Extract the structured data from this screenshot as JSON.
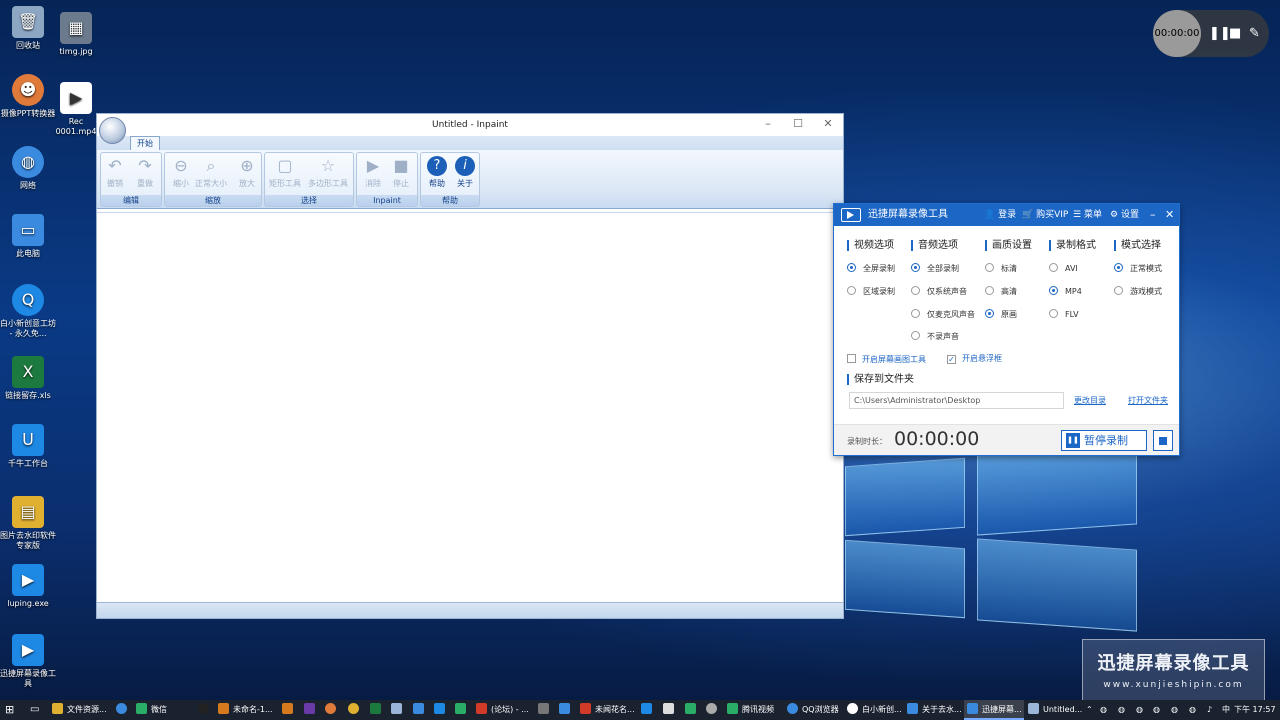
{
  "desktop": {
    "icons": [
      {
        "label": "回收站",
        "icon": "recycle-bin-icon",
        "color": "#8ca6c4"
      },
      {
        "label": "timg.jpg",
        "icon": "image-file-icon",
        "color": "#6b7a8c"
      },
      {
        "label": "摄像PPT转换器",
        "icon": "ppt-converter-icon",
        "color": "#e07a3a"
      },
      {
        "label": "Rec 0001.mp4",
        "icon": "video-file-icon",
        "color": "#ffffff"
      },
      {
        "label": "网络",
        "icon": "network-icon",
        "color": "#3a8ae0"
      },
      {
        "label": "此电脑",
        "icon": "computer-icon",
        "color": "#3a8ae0"
      },
      {
        "label": "白小新创意工坊 - 永久免...",
        "icon": "app-icon",
        "color": "#1e88e5"
      },
      {
        "label": "链接留存.xls",
        "icon": "excel-file-icon",
        "color": "#1d7a3e"
      },
      {
        "label": "千牛工作台",
        "icon": "qianniu-icon",
        "color": "#1e88e5"
      },
      {
        "label": "图片去水印软件专家版",
        "icon": "folder-icon",
        "color": "#e0b030"
      },
      {
        "label": "luping.exe",
        "icon": "recorder-app-icon",
        "color": "#1e88e5"
      },
      {
        "label": "迅捷屏幕录像工具",
        "icon": "recorder-app-icon",
        "color": "#1e88e5"
      }
    ]
  },
  "float_recorder": {
    "time": "00:00:00"
  },
  "inpaint": {
    "title": "Untitled - Inpaint",
    "tab": "开始",
    "groups": [
      {
        "label": "编辑",
        "buttons": [
          "撤销",
          "重做"
        ]
      },
      {
        "label": "缩放",
        "buttons": [
          "缩小",
          "正常大小",
          "放大"
        ]
      },
      {
        "label": "选择",
        "buttons": [
          "矩形工具",
          "多边形工具"
        ]
      },
      {
        "label": "Inpaint",
        "buttons": [
          "消除",
          "停止"
        ]
      },
      {
        "label": "帮助",
        "buttons": [
          "帮助",
          "关于"
        ]
      }
    ]
  },
  "recorder": {
    "title": "迅捷屏幕录像工具",
    "login": "登录",
    "buy_vip": "购买VIP",
    "menu": "菜单",
    "settings": "设置",
    "sections": {
      "video": "视频选项",
      "audio": "音频选项",
      "quality": "画质设置",
      "format": "录制格式",
      "mode": "模式选择"
    },
    "video_options": [
      "全屏录制",
      "区域录制"
    ],
    "audio_options": [
      "全部录制",
      "仅系统声音",
      "仅麦克风声音",
      "不录声音"
    ],
    "quality_options": [
      "标清",
      "高清",
      "原画"
    ],
    "format_options": [
      "AVI",
      "MP4",
      "FLV"
    ],
    "mode_options": [
      "正常模式",
      "游戏模式"
    ],
    "check_screen_tool": "开启屏幕画图工具",
    "check_float": "开启悬浮框",
    "save_folder_title": "保存到文件夹",
    "save_path": "C:\\Users\\Administrator\\Desktop",
    "change_dir": "更改目录",
    "open_folder": "打开文件夹",
    "duration_label": "录制时长：",
    "duration": "00:00:00",
    "pause_label": "暂停录制"
  },
  "watermark": {
    "line1": "迅捷屏幕录像工具",
    "line2": "www.xunjieshipin.com"
  },
  "taskbar": {
    "items": [
      {
        "label": "文件资源...",
        "color": "#e0b030"
      },
      {
        "label": "微信",
        "color": "#2aae67"
      },
      {
        "label": "未命名-1...",
        "color": "#d57a1f"
      },
      {
        "label": "(论坛) - ...",
        "color": "#d23a2a"
      },
      {
        "label": "未闻花名...",
        "color": "#d23a2a"
      },
      {
        "label": "腾讯视频",
        "color": "#2aae67"
      },
      {
        "label": "QQ浏览器",
        "color": "#3a8ae0"
      },
      {
        "label": "白小新创...",
        "color": "#ffffff"
      },
      {
        "label": "关于去水...",
        "color": "#3a8ae0"
      },
      {
        "label": "迅捷屏幕...",
        "color": "#3a8ae0"
      },
      {
        "label": "Untitled...",
        "color": "#9bb5d8"
      }
    ],
    "time": "下午 17:57"
  }
}
